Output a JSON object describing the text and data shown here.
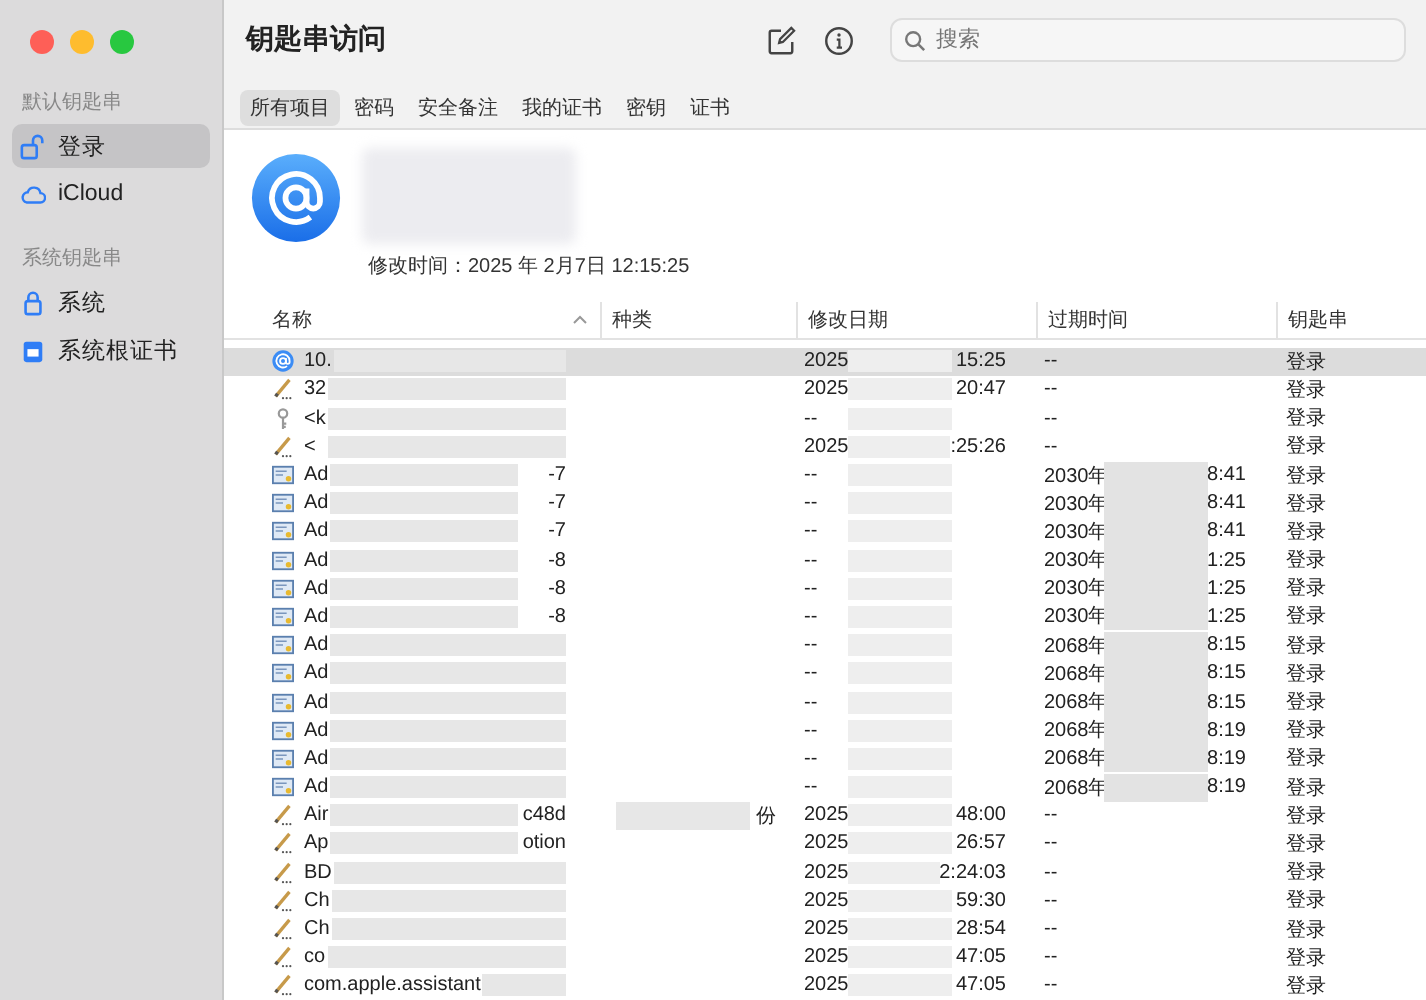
{
  "window": {
    "title": "钥匙串访问"
  },
  "sidebar": {
    "sections": [
      {
        "heading": "默认钥匙串",
        "items": [
          {
            "label": "登录",
            "selected": true
          },
          {
            "label": "iCloud",
            "selected": false
          }
        ]
      },
      {
        "heading": "系统钥匙串",
        "items": [
          {
            "label": "系统",
            "selected": false
          },
          {
            "label": "系统根证书",
            "selected": false
          }
        ]
      }
    ]
  },
  "search": {
    "placeholder": "搜索"
  },
  "tabs": [
    {
      "label": "所有项目",
      "selected": true
    },
    {
      "label": "密码",
      "selected": false
    },
    {
      "label": "安全备注",
      "selected": false
    },
    {
      "label": "我的证书",
      "selected": false
    },
    {
      "label": "密钥",
      "selected": false
    },
    {
      "label": "证书",
      "selected": false
    }
  ],
  "detail": {
    "modified": "修改时间：2025 年 2月7日 12:15:25"
  },
  "table": {
    "columns": [
      "名称",
      "种类",
      "修改日期",
      "过期时间",
      "钥匙串"
    ],
    "rows": [
      {
        "kind": "internet",
        "name": "10.",
        "name_tail": "",
        "kind_tail": "",
        "date": "2025",
        "date_tail": "15:25",
        "expires": "--",
        "expires_tail": "",
        "keychain": "登录",
        "selected": true
      },
      {
        "kind": "password",
        "name": "32",
        "name_tail": "",
        "kind_tail": "",
        "date": "2025",
        "date_tail": "20:47",
        "expires": "--",
        "expires_tail": "",
        "keychain": "登录",
        "selected": false
      },
      {
        "kind": "key",
        "name": "<k",
        "name_tail": "",
        "kind_tail": "",
        "date": "--",
        "date_tail": "",
        "expires": "--",
        "expires_tail": "",
        "keychain": "登录",
        "selected": false
      },
      {
        "kind": "password",
        "name": "<",
        "name_tail": "",
        "kind_tail": "",
        "date": "2025",
        "date_tail": ":25:26",
        "expires": "--",
        "expires_tail": "",
        "keychain": "登录",
        "selected": false
      },
      {
        "kind": "certificate",
        "name": "Ad",
        "name_tail": "-7",
        "kind_tail": "",
        "date": "--",
        "date_tail": "",
        "expires": "2030年",
        "expires_tail": "8:41",
        "keychain": "登录",
        "selected": false
      },
      {
        "kind": "certificate",
        "name": "Ad",
        "name_tail": "-7",
        "kind_tail": "",
        "date": "--",
        "date_tail": "",
        "expires": "2030年",
        "expires_tail": "8:41",
        "keychain": "登录",
        "selected": false
      },
      {
        "kind": "certificate",
        "name": "Ad",
        "name_tail": "-7",
        "kind_tail": "",
        "date": "--",
        "date_tail": "",
        "expires": "2030年",
        "expires_tail": "8:41",
        "keychain": "登录",
        "selected": false
      },
      {
        "kind": "certificate",
        "name": "Ad",
        "name_tail": "-8",
        "kind_tail": "",
        "date": "--",
        "date_tail": "",
        "expires": "2030年",
        "expires_tail": "1:25",
        "keychain": "登录",
        "selected": false
      },
      {
        "kind": "certificate",
        "name": "Ad",
        "name_tail": "-8",
        "kind_tail": "",
        "date": "--",
        "date_tail": "",
        "expires": "2030年",
        "expires_tail": "1:25",
        "keychain": "登录",
        "selected": false
      },
      {
        "kind": "certificate",
        "name": "Ad",
        "name_tail": "-8",
        "kind_tail": "",
        "date": "--",
        "date_tail": "",
        "expires": "2030年",
        "expires_tail": "1:25",
        "keychain": "登录",
        "selected": false
      },
      {
        "kind": "certificate",
        "name": "Ad",
        "name_tail": "",
        "kind_tail": "",
        "date": "--",
        "date_tail": "",
        "expires": "2068年",
        "expires_tail": "8:15",
        "keychain": "登录",
        "selected": false
      },
      {
        "kind": "certificate",
        "name": "Ad",
        "name_tail": "",
        "kind_tail": "",
        "date": "--",
        "date_tail": "",
        "expires": "2068年",
        "expires_tail": "8:15",
        "keychain": "登录",
        "selected": false
      },
      {
        "kind": "certificate",
        "name": "Ad",
        "name_tail": "",
        "kind_tail": "",
        "date": "--",
        "date_tail": "",
        "expires": "2068年",
        "expires_tail": "8:15",
        "keychain": "登录",
        "selected": false
      },
      {
        "kind": "certificate",
        "name": "Ad",
        "name_tail": "",
        "kind_tail": "",
        "date": "--",
        "date_tail": "",
        "expires": "2068年",
        "expires_tail": "8:19",
        "keychain": "登录",
        "selected": false
      },
      {
        "kind": "certificate",
        "name": "Ad",
        "name_tail": "",
        "kind_tail": "",
        "date": "--",
        "date_tail": "",
        "expires": "2068年",
        "expires_tail": "8:19",
        "keychain": "登录",
        "selected": false
      },
      {
        "kind": "certificate",
        "name": "Ad",
        "name_tail": "",
        "kind_tail": "",
        "date": "--",
        "date_tail": "",
        "expires": "2068年",
        "expires_tail": "8:19",
        "keychain": "登录",
        "selected": false
      },
      {
        "kind": "password",
        "name": "Air",
        "name_tail": "c48d",
        "kind_tail": "份",
        "date": "2025",
        "date_tail": "48:00",
        "expires": "--",
        "expires_tail": "",
        "keychain": "登录",
        "selected": false
      },
      {
        "kind": "password",
        "name": "Ap",
        "name_tail": "otion",
        "kind_tail": "",
        "date": "2025",
        "date_tail": "26:57",
        "expires": "--",
        "expires_tail": "",
        "keychain": "登录",
        "selected": false
      },
      {
        "kind": "password",
        "name": "BD",
        "name_tail": "",
        "kind_tail": "",
        "date": "2025",
        "date_tail": "2:24:03",
        "expires": "--",
        "expires_tail": "",
        "keychain": "登录",
        "selected": false
      },
      {
        "kind": "password",
        "name": "Ch",
        "name_tail": "",
        "kind_tail": "",
        "date": "2025",
        "date_tail": "59:30",
        "expires": "--",
        "expires_tail": "",
        "keychain": "登录",
        "selected": false
      },
      {
        "kind": "password",
        "name": "Ch",
        "name_tail": "",
        "kind_tail": "",
        "date": "2025",
        "date_tail": "28:54",
        "expires": "--",
        "expires_tail": "",
        "keychain": "登录",
        "selected": false
      },
      {
        "kind": "password",
        "name": "co",
        "name_tail": "",
        "kind_tail": "",
        "date": "2025",
        "date_tail": "47:05",
        "expires": "--",
        "expires_tail": "",
        "keychain": "登录",
        "selected": false
      },
      {
        "kind": "password",
        "name": "com.apple.assistant",
        "name_tail": "",
        "kind_tail": "",
        "date": "2025",
        "date_tail": "47:05",
        "expires": "--",
        "expires_tail": "",
        "keychain": "登录",
        "selected": false
      }
    ]
  }
}
